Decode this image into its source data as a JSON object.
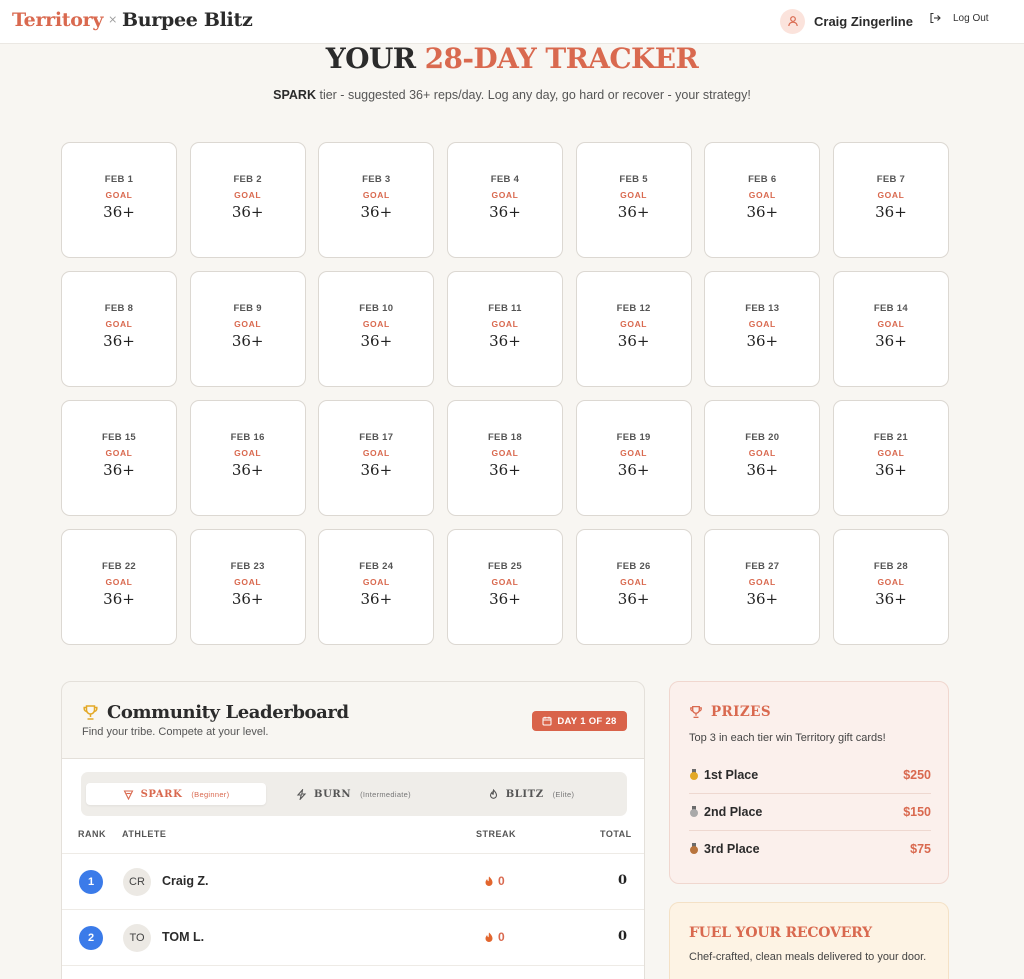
{
  "header": {
    "brand_primary": "Territory",
    "brand_separator": "×",
    "brand_secondary": "Burpee Blitz",
    "user_name": "Craig Zingerline",
    "logout_label": "Log Out"
  },
  "hero": {
    "title_plain": "YOUR ",
    "title_accent": "28-DAY TRACKER",
    "tier_name": "SPARK",
    "subtitle_rest": " tier - suggested 36+ reps/day. Log any day, go hard or recover - your strategy!"
  },
  "tracker": {
    "goal_label": "GOAL",
    "days": [
      {
        "date": "FEB 1",
        "goal": "36+"
      },
      {
        "date": "FEB 2",
        "goal": "36+"
      },
      {
        "date": "FEB 3",
        "goal": "36+"
      },
      {
        "date": "FEB 4",
        "goal": "36+"
      },
      {
        "date": "FEB 5",
        "goal": "36+"
      },
      {
        "date": "FEB 6",
        "goal": "36+"
      },
      {
        "date": "FEB 7",
        "goal": "36+"
      },
      {
        "date": "FEB 8",
        "goal": "36+"
      },
      {
        "date": "FEB 9",
        "goal": "36+"
      },
      {
        "date": "FEB 10",
        "goal": "36+"
      },
      {
        "date": "FEB 11",
        "goal": "36+"
      },
      {
        "date": "FEB 12",
        "goal": "36+"
      },
      {
        "date": "FEB 13",
        "goal": "36+"
      },
      {
        "date": "FEB 14",
        "goal": "36+"
      },
      {
        "date": "FEB 15",
        "goal": "36+"
      },
      {
        "date": "FEB 16",
        "goal": "36+"
      },
      {
        "date": "FEB 17",
        "goal": "36+"
      },
      {
        "date": "FEB 18",
        "goal": "36+"
      },
      {
        "date": "FEB 19",
        "goal": "36+"
      },
      {
        "date": "FEB 20",
        "goal": "36+"
      },
      {
        "date": "FEB 21",
        "goal": "36+"
      },
      {
        "date": "FEB 22",
        "goal": "36+"
      },
      {
        "date": "FEB 23",
        "goal": "36+"
      },
      {
        "date": "FEB 24",
        "goal": "36+"
      },
      {
        "date": "FEB 25",
        "goal": "36+"
      },
      {
        "date": "FEB 26",
        "goal": "36+"
      },
      {
        "date": "FEB 27",
        "goal": "36+"
      },
      {
        "date": "FEB 28",
        "goal": "36+"
      }
    ]
  },
  "leaderboard": {
    "title": "Community Leaderboard",
    "subtitle": "Find your tribe. Compete at your level.",
    "day_badge": "DAY 1 OF 28",
    "tiers": [
      {
        "name": "SPARK",
        "level": "(Beginner)",
        "icon": "spark-icon",
        "active": true
      },
      {
        "name": "BURN",
        "level": "(Intermediate)",
        "icon": "bolt-icon",
        "active": false
      },
      {
        "name": "BLITZ",
        "level": "(Elite)",
        "icon": "flame-icon",
        "active": false
      }
    ],
    "columns": {
      "rank": "RANK",
      "athlete": "ATHLETE",
      "streak": "STREAK",
      "total": "TOTAL"
    },
    "rows": [
      {
        "rank": "1",
        "initials": "CR",
        "name": "Craig Z.",
        "streak": "0",
        "total": "0"
      },
      {
        "rank": "2",
        "initials": "TO",
        "name": "TOM L.",
        "streak": "0",
        "total": "0"
      }
    ],
    "accent_color": "#3b7be9"
  },
  "prizes": {
    "title": "PRIZES",
    "description": "Top 3 in each tier win Territory gift cards!",
    "items": [
      {
        "place": "1st Place",
        "amount": "$250",
        "medal": "gold-medal-icon"
      },
      {
        "place": "2nd Place",
        "amount": "$150",
        "medal": "silver-medal-icon"
      },
      {
        "place": "3rd Place",
        "amount": "$75",
        "medal": "bronze-medal-icon"
      }
    ]
  },
  "fuel": {
    "title": "FUEL YOUR RECOVERY",
    "description": "Chef-crafted, clean meals delivered to your door."
  },
  "colors": {
    "brand": "#d9694f",
    "background": "#f8f6f2"
  }
}
